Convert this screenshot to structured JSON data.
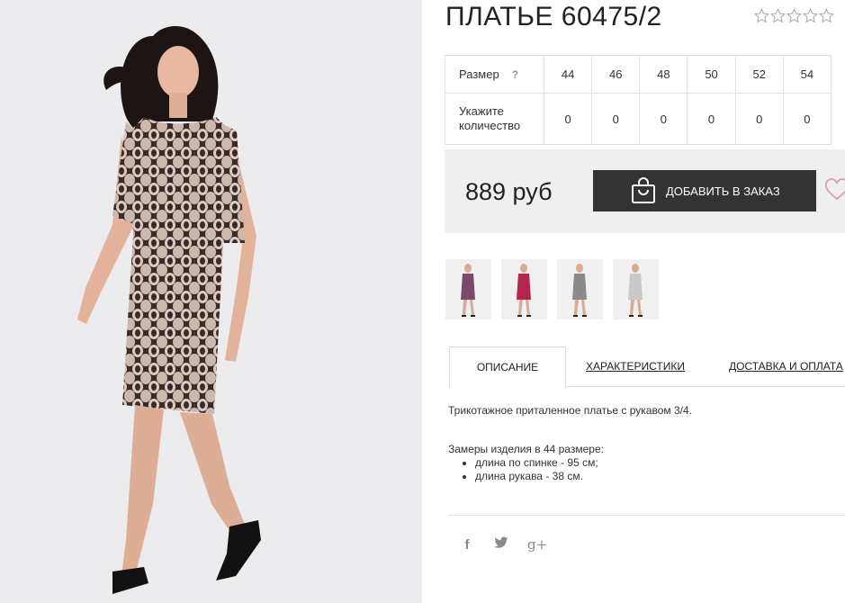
{
  "product": {
    "title": "ПЛАТЬЕ 60475/2",
    "rating": 0,
    "rating_max": 5
  },
  "sizes_table": {
    "size_label": "Размер",
    "help": "?",
    "quantity_label": "Укажите количество",
    "sizes": [
      "44",
      "46",
      "48",
      "50",
      "52",
      "54"
    ],
    "quantities": [
      "0",
      "0",
      "0",
      "0",
      "0",
      "0"
    ]
  },
  "order": {
    "price": "889 руб",
    "add_button": "ДОБАВИТЬ В ЗАКАЗ"
  },
  "thumbnails": [
    {
      "color": "#7b4a6a"
    },
    {
      "color": "#b3244f"
    },
    {
      "color": "#8a8a8a"
    },
    {
      "color": "#c9c9c9"
    }
  ],
  "tabs": {
    "description": "ОПИСАНИЕ",
    "characteristics": "ХАРАКТЕРИСТИКИ",
    "delivery": "ДОСТАВКА И ОПЛАТА"
  },
  "description": {
    "text": "Трикотажное приталенное платье с рукавом 3/4.",
    "measurements_title": "Замеры изделия в 44 размере:",
    "measurements": [
      "длина по спинке - 95 см;",
      "длина рукава - 38 см."
    ]
  },
  "social": {
    "facebook": "f",
    "twitter": "twitter-icon",
    "googleplus": "g+"
  },
  "colors": {
    "dress": "#5a4744",
    "button": "#333333",
    "panel": "#efefef"
  }
}
